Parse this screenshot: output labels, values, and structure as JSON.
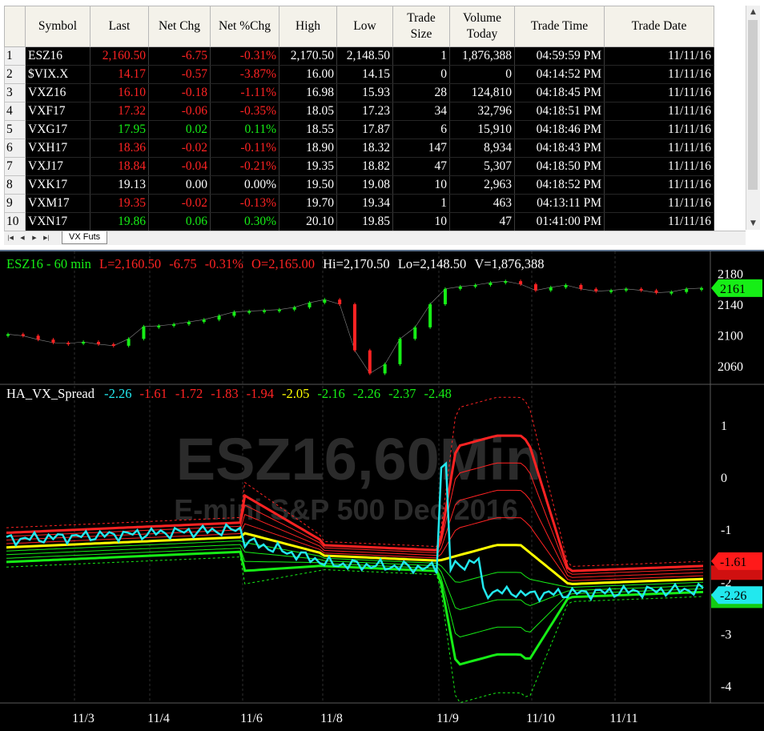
{
  "quote_table": {
    "columns": [
      "Symbol",
      "Last",
      "Net Chg",
      "Net %Chg",
      "High",
      "Low",
      "Trade Size",
      "Volume Today",
      "Trade Time",
      "Trade Date"
    ],
    "col_header_lines": [
      [
        "Symbol"
      ],
      [
        "Last"
      ],
      [
        "Net Chg"
      ],
      [
        "Net %Chg"
      ],
      [
        "High"
      ],
      [
        "Low"
      ],
      [
        "Trade",
        "Size"
      ],
      [
        "Volume",
        "Today"
      ],
      [
        "Trade Time"
      ],
      [
        "Trade Date"
      ]
    ],
    "rows": [
      {
        "n": "1",
        "symbol": "ESZ16",
        "last": "2,160.50",
        "chg": "-6.75",
        "pct": "-0.31%",
        "high": "2,170.50",
        "low": "2,148.50",
        "size": "1",
        "volume": "1,876,388",
        "time": "04:59:59 PM",
        "date": "11/11/16",
        "color": "red"
      },
      {
        "n": "2",
        "symbol": "$VIX.X",
        "last": "14.17",
        "chg": "-0.57",
        "pct": "-3.87%",
        "high": "16.00",
        "low": "14.15",
        "size": "0",
        "volume": "0",
        "time": "04:14:52 PM",
        "date": "11/11/16",
        "color": "red"
      },
      {
        "n": "3",
        "symbol": "VXZ16",
        "last": "16.10",
        "chg": "-0.18",
        "pct": "-1.11%",
        "high": "16.98",
        "low": "15.93",
        "size": "28",
        "volume": "124,810",
        "time": "04:18:45 PM",
        "date": "11/11/16",
        "color": "red"
      },
      {
        "n": "4",
        "symbol": "VXF17",
        "last": "17.32",
        "chg": "-0.06",
        "pct": "-0.35%",
        "high": "18.05",
        "low": "17.23",
        "size": "34",
        "volume": "32,796",
        "time": "04:18:51 PM",
        "date": "11/11/16",
        "color": "red"
      },
      {
        "n": "5",
        "symbol": "VXG17",
        "last": "17.95",
        "chg": "0.02",
        "pct": "0.11%",
        "high": "18.55",
        "low": "17.87",
        "size": "6",
        "volume": "15,910",
        "time": "04:18:46 PM",
        "date": "11/11/16",
        "color": "green"
      },
      {
        "n": "6",
        "symbol": "VXH17",
        "last": "18.36",
        "chg": "-0.02",
        "pct": "-0.11%",
        "high": "18.90",
        "low": "18.32",
        "size": "147",
        "volume": "8,934",
        "time": "04:18:43 PM",
        "date": "11/11/16",
        "color": "red"
      },
      {
        "n": "7",
        "symbol": "VXJ17",
        "last": "18.84",
        "chg": "-0.04",
        "pct": "-0.21%",
        "high": "19.35",
        "low": "18.82",
        "size": "47",
        "volume": "5,307",
        "time": "04:18:50 PM",
        "date": "11/11/16",
        "color": "red"
      },
      {
        "n": "8",
        "symbol": "VXK17",
        "last": "19.13",
        "chg": "0.00",
        "pct": "0.00%",
        "high": "19.50",
        "low": "19.08",
        "size": "10",
        "volume": "2,963",
        "time": "04:18:52 PM",
        "date": "11/11/16",
        "color": "white"
      },
      {
        "n": "9",
        "symbol": "VXM17",
        "last": "19.35",
        "chg": "-0.02",
        "pct": "-0.13%",
        "high": "19.70",
        "low": "19.34",
        "size": "1",
        "volume": "463",
        "time": "04:13:11 PM",
        "date": "11/11/16",
        "color": "red"
      },
      {
        "n": "10",
        "symbol": "VXN17",
        "last": "19.86",
        "chg": "0.06",
        "pct": "0.30%",
        "high": "20.10",
        "low": "19.85",
        "size": "10",
        "volume": "47",
        "time": "01:41:00 PM",
        "date": "11/11/16",
        "color": "green"
      }
    ],
    "sheet_tab": "VX Futs"
  },
  "colors": {
    "red": "#ff2323",
    "green": "#16ee16",
    "white": "#ffffff",
    "cyan": "#22e8ee",
    "yellow": "#ffff00",
    "up_candle": "#16ee16",
    "down_candle": "#ff2323"
  },
  "price_header": {
    "title": "ESZ16 - 60 min",
    "last": "L=2,160.50",
    "chg": "-6.75",
    "pct": "-0.31%",
    "open": "O=2,165.00",
    "hi": "Hi=2,170.50",
    "lo": "Lo=2,148.50",
    "vol": "V=1,876,388"
  },
  "price_axis": {
    "ticks": [
      "2180",
      "2140",
      "2100",
      "2060"
    ],
    "badge": "2161"
  },
  "indicator_header": {
    "name": "HA_VX_Spread",
    "values": [
      {
        "v": "-2.26",
        "c": "cyan"
      },
      {
        "v": "-1.61",
        "c": "red"
      },
      {
        "v": "-1.72",
        "c": "red"
      },
      {
        "v": "-1.83",
        "c": "red"
      },
      {
        "v": "-1.94",
        "c": "red"
      },
      {
        "v": "-2.05",
        "c": "yellow"
      },
      {
        "v": "-2.16",
        "c": "green"
      },
      {
        "v": "-2.26",
        "c": "green"
      },
      {
        "v": "-2.37",
        "c": "green"
      },
      {
        "v": "-2.48",
        "c": "green"
      }
    ]
  },
  "indicator_axis": {
    "ticks": [
      "1",
      "0",
      "-1",
      "-2",
      "-3",
      "-4"
    ],
    "badge_red": "-1.61",
    "badge_cyan": "-2.26"
  },
  "watermark": {
    "symbol": "ESZ16,60Min",
    "description": "E-mini S&P 500 Dec 2016"
  },
  "x_axis": {
    "labels": [
      "11/3",
      "11/4",
      "11/6",
      "11/8",
      "11/9",
      "11/10",
      "11/11"
    ]
  },
  "chart_data": {
    "type": "line",
    "price_series": {
      "name": "ESZ16 - 60 min",
      "x_sessions": [
        "11/3",
        "11/4",
        "11/6",
        "11/8",
        "11/9",
        "11/10",
        "11/11"
      ],
      "close": [
        2101,
        2099,
        2094,
        2090,
        2089,
        2091,
        2088,
        2086,
        2095,
        2111,
        2112,
        2114,
        2117,
        2120,
        2125,
        2130,
        2131,
        2132,
        2133,
        2136,
        2142,
        2146,
        2140,
        2080,
        2050,
        2062,
        2095,
        2110,
        2140,
        2160,
        2163,
        2165,
        2168,
        2170,
        2166,
        2158,
        2162,
        2165,
        2160,
        2157,
        2158,
        2160,
        2158,
        2155,
        2156,
        2160,
        2161
      ]
    },
    "indicator_series": [
      {
        "name": "HA_VX_Spread",
        "color": "cyan",
        "last": -2.26
      },
      {
        "name": "upper_band_dotted",
        "color": "red"
      },
      {
        "name": "upper_band_1",
        "color": "red",
        "last": -1.61
      },
      {
        "name": "upper_band_2",
        "color": "red",
        "last": -1.72
      },
      {
        "name": "upper_band_3",
        "color": "red",
        "last": -1.83
      },
      {
        "name": "upper_band_4",
        "color": "red",
        "last": -1.94
      },
      {
        "name": "mid_line",
        "color": "yellow",
        "last": -2.05
      },
      {
        "name": "lower_band_1",
        "color": "green",
        "last": -2.16
      },
      {
        "name": "lower_band_2",
        "color": "green",
        "last": -2.26
      },
      {
        "name": "lower_band_3",
        "color": "green",
        "last": -2.37
      },
      {
        "name": "lower_band_4",
        "color": "green",
        "last": -2.48
      },
      {
        "name": "lower_band_dotted",
        "color": "green"
      }
    ],
    "x_labels": [
      "11/3",
      "11/4",
      "11/6",
      "11/8",
      "11/9",
      "11/10",
      "11/11"
    ],
    "price_ylim": [
      2040,
      2190
    ],
    "indicator_ylim": [
      -4.3,
      1.6
    ]
  }
}
